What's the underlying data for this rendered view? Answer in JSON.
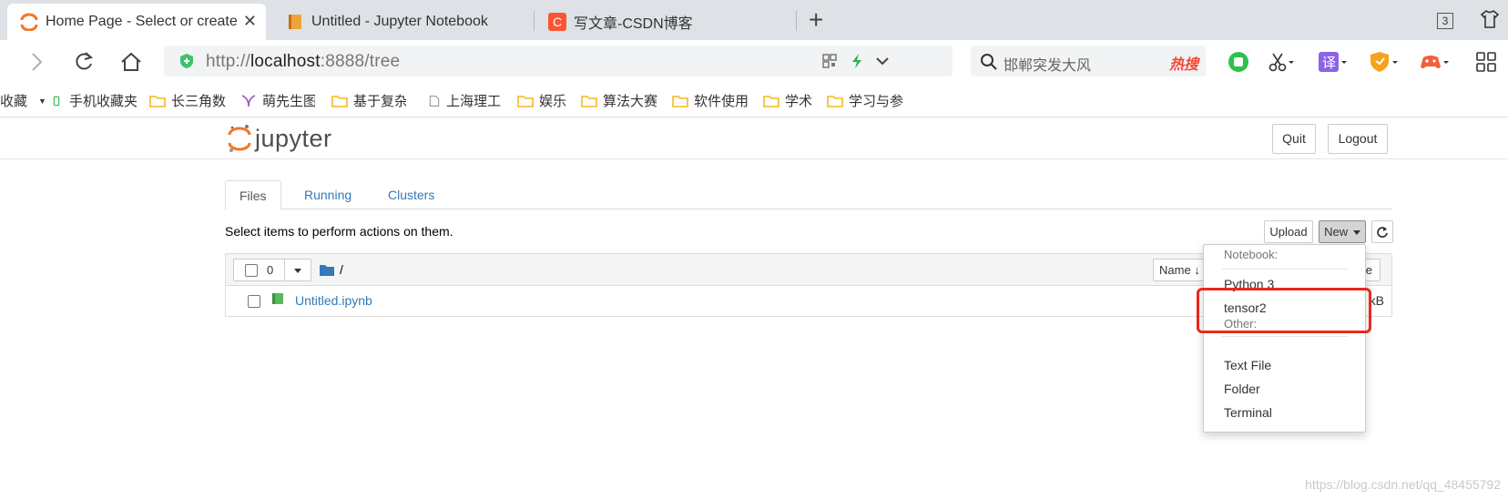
{
  "browser": {
    "tabs": [
      {
        "label": "Home Page - Select or create",
        "icon": "jupyter-icon"
      },
      {
        "label": "Untitled - Jupyter Notebook",
        "icon": "notebook-icon"
      },
      {
        "label": "写文章-CSDN博客",
        "icon": "csdn-icon"
      }
    ],
    "tab_count": "3",
    "url_prefix": "http://",
    "url_host": "localhost",
    "url_rest": ":8888/tree",
    "search_text": "邯郸突发大风",
    "search_badge": "热搜",
    "ext_translate": "译"
  },
  "bookmarks": [
    "收藏",
    "手机收藏夹",
    "长三角数",
    "萌先生图",
    "基于复杂",
    "上海理工",
    "娱乐",
    "算法大赛",
    "软件使用",
    "学术",
    "学习与参"
  ],
  "jupyter": {
    "logo_text": "jupyter",
    "quit_label": "Quit",
    "logout_label": "Logout",
    "tabs": [
      "Files",
      "Running",
      "Clusters"
    ],
    "hint": "Select items to perform actions on them.",
    "upload_label": "Upload",
    "new_label": "New",
    "selected_count": "0",
    "breadcrumb": "/",
    "name_sort": "Name",
    "size_fragment": "ze",
    "files": [
      {
        "name": "Untitled.ipynb",
        "size_fragment": "kB"
      }
    ]
  },
  "new_menu": {
    "notebook_header": "Notebook:",
    "notebook_items": [
      "Python 3",
      "tensor2"
    ],
    "other_header": "Other:",
    "other_items": [
      "Text File",
      "Folder",
      "Terminal"
    ]
  },
  "watermark": "https://blog.csdn.net/qq_48455792",
  "colors": {
    "accent_link": "#337ab7",
    "jupyter_orange": "#f37726",
    "highlight_red": "#e8281e"
  }
}
